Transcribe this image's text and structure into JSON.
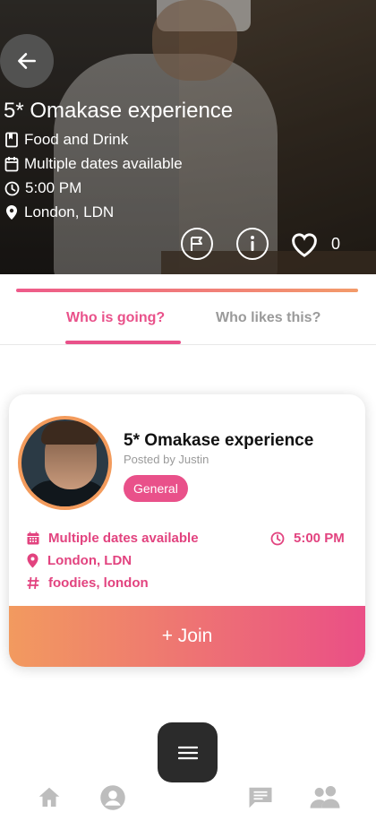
{
  "hero": {
    "title": "5* Omakase experience",
    "category": "Food and Drink",
    "dates": "Multiple dates available",
    "time": "5:00 PM",
    "location": "London, LDN",
    "like_count": "0"
  },
  "tabs": [
    {
      "label": "Who is going?",
      "active": true
    },
    {
      "label": "Who likes this?",
      "active": false
    }
  ],
  "card": {
    "title": "5* Omakase experience",
    "posted_by": "Posted by Justin",
    "tag": "General",
    "dates": "Multiple dates available",
    "time": "5:00 PM",
    "location": "London, LDN",
    "hashtags": "foodies, london",
    "join_label": "+ Join"
  },
  "icons": {
    "back": "arrow-left-icon",
    "category": "bookmark-icon",
    "calendar": "calendar-icon",
    "clock": "clock-icon",
    "location": "location-pin-icon",
    "report": "flag-icon",
    "info": "info-icon",
    "like": "heart-icon",
    "hashtag": "hashtag-icon",
    "menu": "hamburger-menu-icon",
    "nav": [
      "home-icon",
      "profile-icon",
      "chat-icon",
      "groups-icon"
    ]
  },
  "colors": {
    "accent_pink": "#e9518a",
    "accent_orange": "#f29a5f",
    "dark": "#2b2b2b"
  }
}
